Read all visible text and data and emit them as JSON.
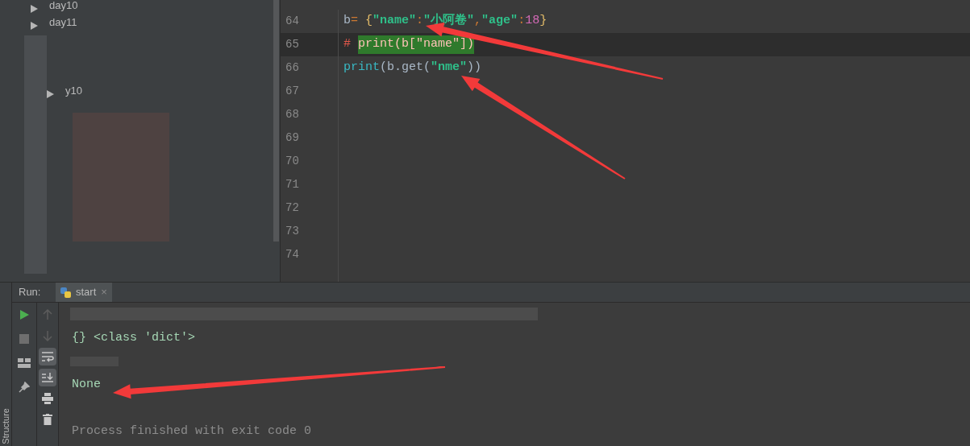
{
  "project_tree": {
    "items": [
      {
        "label": "day10"
      },
      {
        "label": "day11"
      },
      {
        "label": "y10"
      }
    ]
  },
  "editor": {
    "lines": [
      {
        "number": "64",
        "current": false,
        "tokens": [
          {
            "text": "b",
            "kind": "ident"
          },
          {
            "text": "= ",
            "kind": "op"
          },
          {
            "text": "{",
            "kind": "brace"
          },
          {
            "text": "\"name\"",
            "kind": "string"
          },
          {
            "text": ":",
            "kind": "op"
          },
          {
            "text": "\"小阿卷\"",
            "kind": "string"
          },
          {
            "text": ",",
            "kind": "op"
          },
          {
            "text": "\"age\"",
            "kind": "string"
          },
          {
            "text": ":",
            "kind": "op"
          },
          {
            "text": "18",
            "kind": "number"
          },
          {
            "text": "}",
            "kind": "brace"
          }
        ]
      },
      {
        "number": "65",
        "current": true,
        "tokens": [
          {
            "text": "# ",
            "kind": "comment"
          },
          {
            "text": "print(b[\"name\"])",
            "kind": "comment",
            "highlighted": true
          }
        ]
      },
      {
        "number": "66",
        "current": false,
        "tokens": [
          {
            "text": "print",
            "kind": "builtin"
          },
          {
            "text": "(b.get(",
            "kind": "ident"
          },
          {
            "text": "\"nme\"",
            "kind": "string"
          },
          {
            "text": "))",
            "kind": "ident"
          }
        ]
      },
      {
        "number": "67",
        "current": false
      },
      {
        "number": "68",
        "current": false
      },
      {
        "number": "69",
        "current": false
      },
      {
        "number": "70",
        "current": false
      },
      {
        "number": "71",
        "current": false
      },
      {
        "number": "72",
        "current": false
      },
      {
        "number": "73",
        "current": false
      },
      {
        "number": "74",
        "current": false
      }
    ]
  },
  "run_panel": {
    "label": "Run:",
    "tab": {
      "label": "start",
      "close": "×",
      "selected": true
    },
    "left_tools": [
      {
        "kind": "play"
      },
      {
        "kind": "stop"
      },
      {
        "kind": "layout"
      },
      {
        "kind": "pin"
      }
    ],
    "right_tools": [
      {
        "kind": "up",
        "selected": false
      },
      {
        "kind": "down",
        "selected": false
      },
      {
        "kind": "wrap",
        "selected": true
      },
      {
        "kind": "scroll-end",
        "selected": true
      },
      {
        "kind": "print",
        "selected": false
      },
      {
        "kind": "trash",
        "selected": false
      }
    ],
    "console": [
      {
        "text": "{} <class 'dict'>",
        "kind": "output"
      },
      {
        "text": "None",
        "kind": "output"
      },
      {
        "text": "Process finished with exit code 0",
        "kind": "status"
      }
    ]
  },
  "side_tab": "Structure"
}
